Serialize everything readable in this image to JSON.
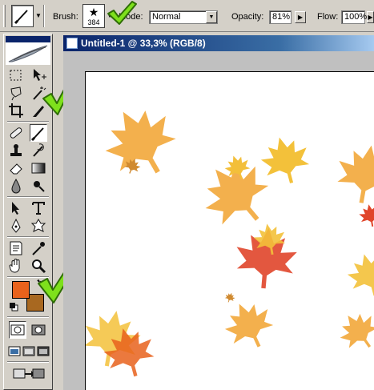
{
  "options_bar": {
    "brush_label": "Brush:",
    "brush_size": "384",
    "mode_label": "Mode:",
    "mode_value": "Normal",
    "opacity_label": "Opacity:",
    "opacity_value": "81%",
    "flow_label": "Flow:",
    "flow_value": "100%"
  },
  "document": {
    "title": "Untitled-1 @ 33,3% (RGB/8)"
  },
  "colors": {
    "foreground": "#e8621c",
    "background": "#a86820",
    "check": "#7ee01c",
    "leaf_orange": "#f2a73a",
    "leaf_red": "#e0452a"
  },
  "tools": [
    "marquee-icon",
    "move-icon",
    "lasso-icon",
    "magic-wand-icon",
    "crop-icon",
    "slice-icon",
    "healing-brush-icon",
    "brush-icon",
    "clone-stamp-icon",
    "history-brush-icon",
    "eraser-icon",
    "gradient-icon",
    "blur-icon",
    "dodge-icon",
    "path-selection-icon",
    "type-icon",
    "pen-icon",
    "custom-shape-icon",
    "notes-icon",
    "eyedropper-icon",
    "hand-icon",
    "zoom-icon"
  ]
}
